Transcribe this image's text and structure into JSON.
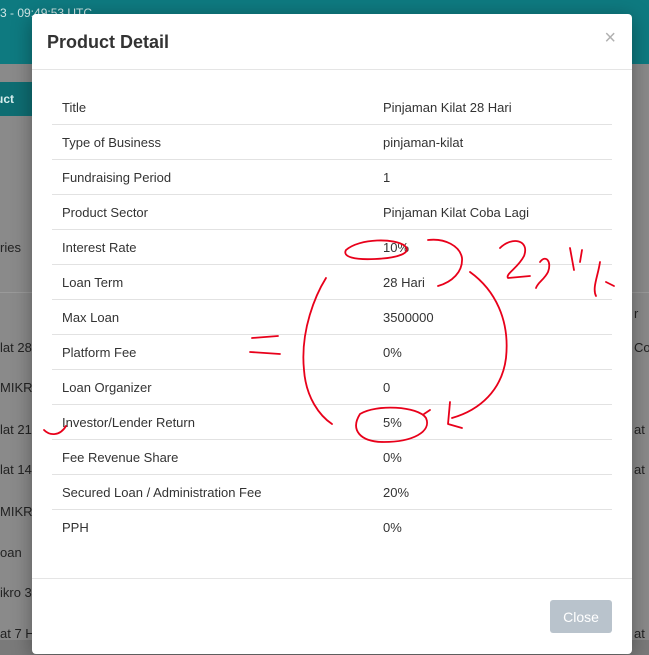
{
  "background": {
    "header_text": "3  -  09:49:53 UTC",
    "breadcrumb": "uct",
    "table_fragments_left": [
      "ries",
      "lat 28",
      "MIKRO",
      "lat 21",
      "lat 14",
      "MIKRO",
      "oan",
      "ikro 3",
      "at 7 H"
    ],
    "table_fragments_right": [
      "r",
      "Co",
      "at c",
      "at B",
      "at M"
    ]
  },
  "modal": {
    "title": "Product Detail",
    "close_icon": "×",
    "rows": [
      {
        "label": "Title",
        "value": "Pinjaman Kilat 28 Hari"
      },
      {
        "label": "Type of Business",
        "value": "pinjaman-kilat"
      },
      {
        "label": "Fundraising Period",
        "value": "1"
      },
      {
        "label": "Product Sector",
        "value": "Pinjaman Kilat Coba Lagi"
      },
      {
        "label": "Interest Rate",
        "value": "10%"
      },
      {
        "label": "Loan Term",
        "value": "28 Hari"
      },
      {
        "label": "Max Loan",
        "value": "3500000"
      },
      {
        "label": "Platform Fee",
        "value": "0%"
      },
      {
        "label": "Loan Organizer",
        "value": "0"
      },
      {
        "label": "Investor/Lender Return",
        "value": "5%"
      },
      {
        "label": "Fee Revenue Share",
        "value": "0%"
      },
      {
        "label": "Secured Loan / Administration Fee",
        "value": "20%"
      },
      {
        "label": "PPH",
        "value": "0%"
      }
    ],
    "footer": {
      "close_label": "Close"
    }
  },
  "colors": {
    "header_bg": "#0e7a80",
    "annotation_ink": "#e8001a",
    "close_button": "#b9c3cc"
  }
}
